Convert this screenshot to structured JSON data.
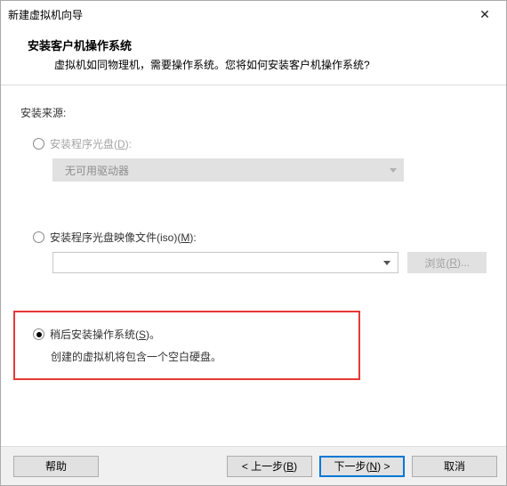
{
  "window": {
    "title": "新建虚拟机向导"
  },
  "header": {
    "title": "安装客户机操作系统",
    "subtitle": "虚拟机如同物理机，需要操作系统。您将如何安装客户机操作系统?"
  },
  "source": {
    "label": "安装来源:"
  },
  "options": {
    "disc": {
      "label_prefix": "安装程序光盘(",
      "hotkey": "D",
      "label_suffix": "):",
      "dropdown_text": "无可用驱动器",
      "selected": false,
      "enabled": false
    },
    "iso": {
      "label_prefix": "安装程序光盘映像文件(iso)(",
      "hotkey": "M",
      "label_suffix": "):",
      "browse_prefix": "浏览(",
      "browse_hotkey": "R",
      "browse_suffix": ")...",
      "selected": false,
      "enabled": true
    },
    "later": {
      "label_prefix": "稍后安装操作系统(",
      "hotkey": "S",
      "label_suffix": ")。",
      "hint": "创建的虚拟机将包含一个空白硬盘。",
      "selected": true
    }
  },
  "footer": {
    "help": "帮助",
    "back_prefix": "< 上一步(",
    "back_hotkey": "B",
    "back_suffix": ")",
    "next_prefix": "下一步(",
    "next_hotkey": "N",
    "next_suffix": ") >",
    "cancel": "取消"
  }
}
